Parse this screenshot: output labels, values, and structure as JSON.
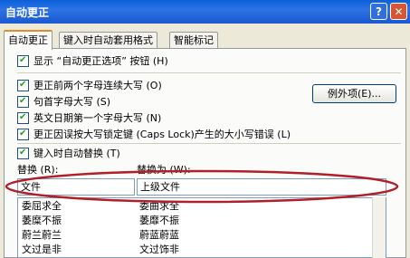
{
  "window": {
    "title": "自动更正",
    "help_label": "?",
    "close_label": "✕"
  },
  "tabs": [
    {
      "label": "自动更正"
    },
    {
      "label": "键入时自动套用格式"
    },
    {
      "label": "智能标记"
    }
  ],
  "options": {
    "show_buttons": "显示 “自动更正选项” 按钮 (H)",
    "two_caps": "更正前两个字母连续大写 (O)",
    "sentence_caps": "句首字母大写 (S)",
    "english_dates": "英文日期第一个字母大写 (N)",
    "caps_lock": "更正因误按大写锁定键 (Caps Lock)产生的大小写错误 (L)",
    "replace_typing": "键入时自动替换 (T)"
  },
  "exceptions_button": "例外项(E)...",
  "replace": {
    "label": "替换 (R):",
    "with_label": "替换为 (W):",
    "value": "文件",
    "with_value": "上级文件"
  },
  "entries": [
    {
      "from": "委屈求全",
      "to": "委曲求全"
    },
    {
      "from": "萎糜不振",
      "to": "萎靡不振"
    },
    {
      "from": "蔚兰蔚兰",
      "to": "蔚蓝蔚蓝"
    },
    {
      "from": "文过是非",
      "to": "文过饰非"
    }
  ],
  "colors": {
    "title_bar": "#1a58cf",
    "highlight_ellipse": "#b0202a",
    "tab_accent": "#e68b2c"
  }
}
